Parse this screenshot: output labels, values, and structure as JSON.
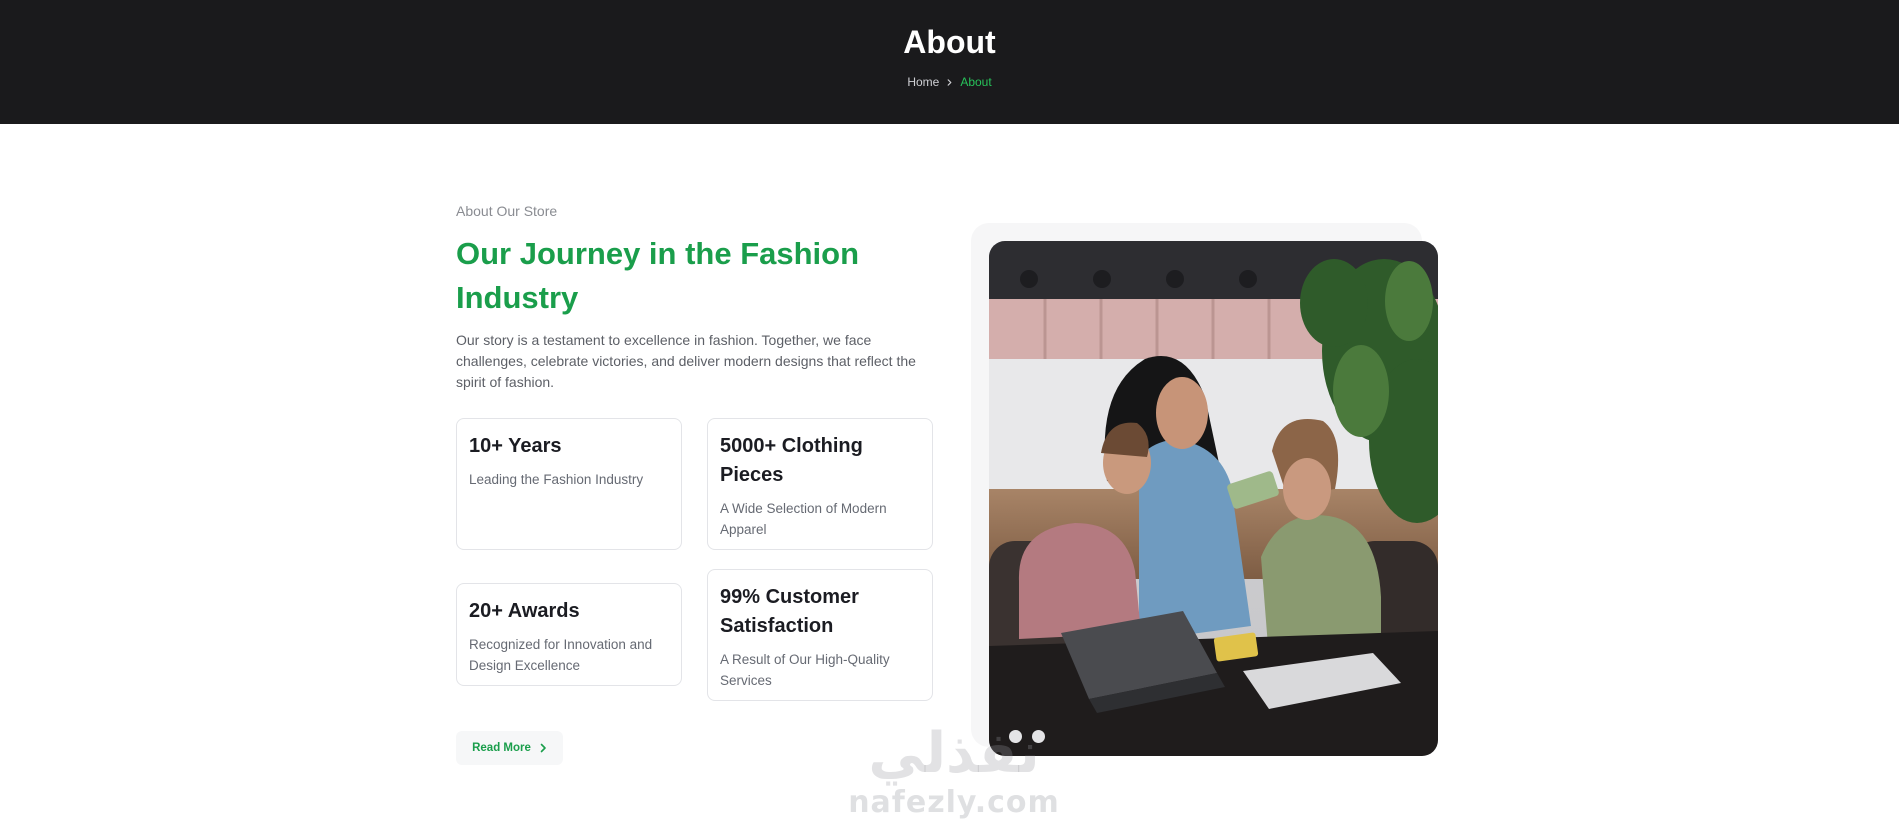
{
  "hero": {
    "title": "About",
    "breadcrumb": {
      "home": "Home",
      "current": "About"
    }
  },
  "about": {
    "eyebrow": "About Our Store",
    "heading": "Our Journey in the Fashion Industry",
    "intro": "Our story is a testament to excellence in fashion. Together, we face challenges, celebrate victories, and deliver modern designs that reflect the spirit of fashion.",
    "stats": [
      {
        "title": "10+ Years",
        "description": "Leading the Fashion Industry"
      },
      {
        "title": "5000+ Clothing Pieces",
        "description": "A Wide Selection of Modern Apparel"
      },
      {
        "title": "20+ Awards",
        "description": "Recognized for Innovation and Design Excellence"
      },
      {
        "title": "99% Customer Satisfaction",
        "description": "A Result of Our High-Quality Services"
      }
    ],
    "read_more_label": "Read More"
  },
  "watermark": {
    "arabic": "نفذلي",
    "latin": "nafezly.com"
  },
  "icons": {
    "breadcrumb_separator": "chevron-right-icon",
    "read_more": "chevron-right-icon"
  },
  "colors": {
    "accent": "#1a9e4b",
    "breadcrumb_active": "#27c25a",
    "hero_background": "#1a1a1c"
  }
}
